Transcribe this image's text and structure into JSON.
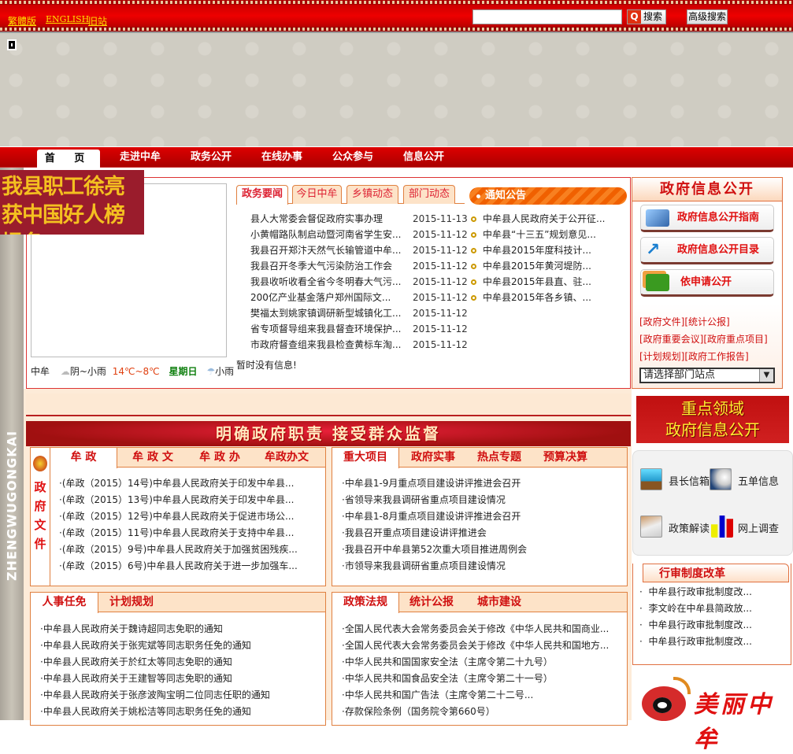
{
  "header": {
    "links": [
      "繁體版",
      "ENGLISH",
      "旧站"
    ],
    "search_placeholder": "",
    "search_label": "搜索",
    "advanced_search_label": "高级搜索"
  },
  "nav": [
    "首 页",
    "走进中牟",
    "政务公开",
    "在线办事",
    "公众参与",
    "信息公开"
  ],
  "side_strip_text": "ZHENGWUGONGKAI",
  "promo_text": "我县职工徐亮获中国好人榜提名",
  "news": {
    "tabs": [
      "政务要闻",
      "今日中牟",
      "乡镇动态",
      "部门动态"
    ],
    "items": [
      {
        "title": "县人大常委会督促政府实事办理",
        "date": "2015-11-13"
      },
      {
        "title": "小黄帽路队制启动暨河南省学生安...",
        "date": "2015-11-12"
      },
      {
        "title": "我县召开郑汴天然气长输管道中牟...",
        "date": "2015-11-12"
      },
      {
        "title": "我县召开冬季大气污染防治工作会",
        "date": "2015-11-12"
      },
      {
        "title": "我县收听收看全省今冬明春大气污...",
        "date": "2015-11-12"
      },
      {
        "title": "200亿产业基金落户郑州国际文...",
        "date": "2015-11-12"
      },
      {
        "title": "樊福太到姚家镇调研新型城镇化工...",
        "date": "2015-11-12"
      },
      {
        "title": "省专项督导组来我县督查环境保护...",
        "date": "2015-11-12"
      },
      {
        "title": "市政府督查组来我县检查黄标车淘...",
        "date": "2015-11-12"
      }
    ],
    "empty_message": "暂时没有信息!"
  },
  "weather": {
    "city": "中牟",
    "today": "阴~小雨",
    "temp": "14℃~8℃",
    "weekday": "星期日",
    "next": "小雨"
  },
  "notice": {
    "title": "通知公告",
    "items": [
      "中牟县人民政府关于公开征...",
      "中牟县“十三五”规划意见...",
      "中牟县2015年度科技计...",
      "中牟县2015年黄河堤防...",
      "中牟县2015年县直、驻...",
      "中牟县2015年各乡镇、..."
    ]
  },
  "info_panel": {
    "title": "政府信息公开",
    "buttons": [
      "政府信息公开指南",
      "政府信息公开目录",
      "依申请公开"
    ],
    "links": [
      "[政府文件]",
      "[统计公报]",
      "[政府重要会议]",
      "[政府重点项目]",
      "[计划规划]",
      "[政府工作报告]"
    ],
    "select_value": "请选择部门站点"
  },
  "banner_text": "明确政府职责  接受群众监督",
  "gov_files": {
    "side_label": "政府文件",
    "tabs": [
      "牟 政",
      "牟 政 文",
      "牟 政 办",
      "牟政办文"
    ],
    "items": [
      "·(牟政（2015）14号)中牟县人民政府关于印发中牟县...",
      "·(牟政（2015）13号)中牟县人民政府关于印发中牟县...",
      "·(牟政（2015）12号)中牟县人民政府关于促进市场公...",
      "·(牟政（2015）11号)中牟县人民政府关于支持中牟县...",
      "·(牟政（2015）9号)中牟县人民政府关于加强贫困残疾...",
      "·(牟政（2015）6号)中牟县人民政府关于进一步加强车..."
    ]
  },
  "projects": {
    "tabs": [
      "重大项目",
      "政府实事",
      "热点专题",
      "预算决算"
    ],
    "items": [
      "·中牟县1-9月重点项目建设讲评推进会召开",
      "·省领导来我县调研省重点项目建设情况",
      "·中牟县1-8月重点项目建设讲评推进会召开",
      "·我县召开重点项目建设讲评推进会",
      "·我县召开中牟县第52次重大项目推进周例会",
      "·市领导来我县调研省重点项目建设情况"
    ]
  },
  "personnel": {
    "tabs": [
      "人事任免",
      "计划规划"
    ],
    "items": [
      "·中牟县人民政府关于魏诗超同志免职的通知",
      "·中牟县人民政府关于张宪斌等同志职务任免的通知",
      "·中牟县人民政府关于於红太等同志免职的通知",
      "·中牟县人民政府关于王建智等同志免职的通知",
      "·中牟县人民政府关于张彦波陶宝明二位同志任职的通知",
      "·中牟县人民政府关于姚松洁等同志职务任免的通知"
    ]
  },
  "policy": {
    "tabs": [
      "政策法规",
      "统计公报",
      "城市建设"
    ],
    "items": [
      "·全国人民代表大会常务委员会关于修改《中华人民共和国商业...",
      "·全国人民代表大会常务委员会关于修改《中华人民共和国地方...",
      "·中华人民共和国国家安全法（主席令第二十九号）",
      "·中华人民共和国食品安全法（主席令第二十一号）",
      "·中华人民共和国广告法（主席令第二十二号...",
      "·存款保险条例（国务院令第660号）"
    ]
  },
  "key_banner": [
    "重点领域",
    "政府信息公开"
  ],
  "quick_links": [
    "县长信箱",
    "五单信息",
    "政策解读",
    "网上调查"
  ],
  "reform": {
    "title": "行审制度改革",
    "items": [
      "中牟县行政审批制度改...",
      "李文岭在中牟县简政放...",
      "中牟县行政审批制度改...",
      "中牟县行政审批制度改..."
    ]
  },
  "weibo_text": "美丽中牟",
  "colors": {
    "brand_red": "#cc0000",
    "accent_orange": "#e08040",
    "link_yellow": "#ffe000"
  }
}
